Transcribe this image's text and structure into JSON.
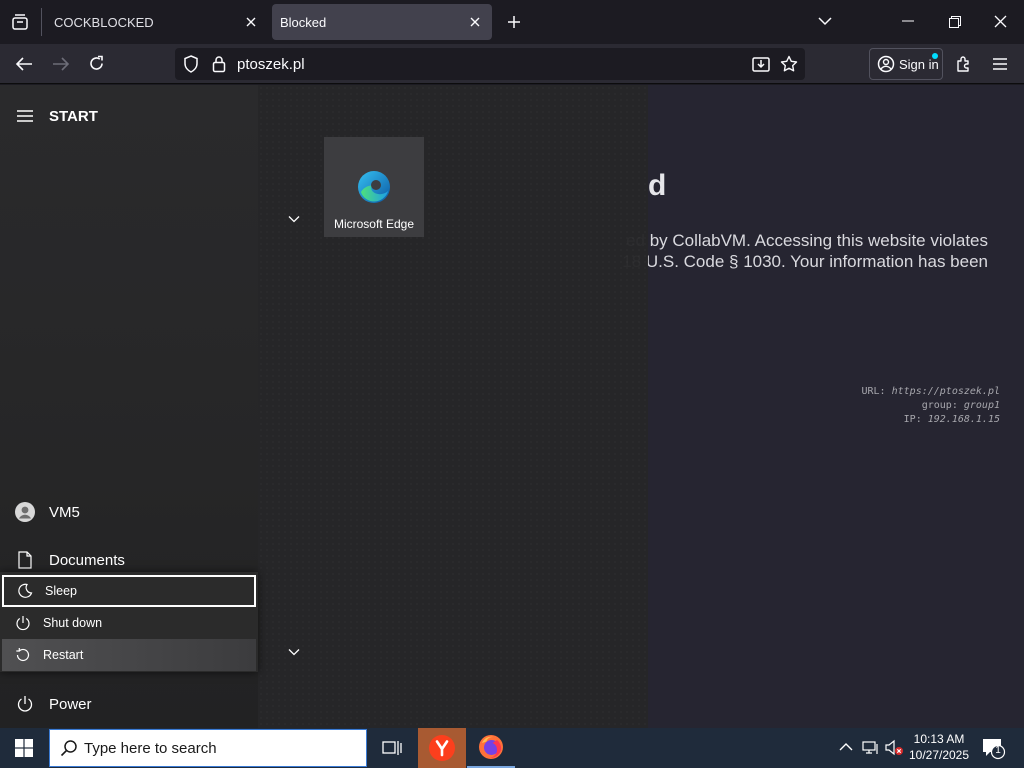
{
  "browser": {
    "tabs": [
      {
        "title": "COCKBLOCKED",
        "active": false
      },
      {
        "title": "Blocked",
        "active": true
      }
    ],
    "url": "ptoszek.pl",
    "sign_in_label": "Sign in"
  },
  "page": {
    "heading_visible_fragment": "d",
    "message_line1": "ed by CollabVM. Accessing this website violates",
    "message_line2": "18 U.S. Code § 1030. Your information has been",
    "meta": {
      "url_label": "URL:",
      "url_value": "https://ptoszek.pl",
      "group_label": "group:",
      "group_value": "group1",
      "ip_label": "IP:",
      "ip_value": "192.168.1.15"
    }
  },
  "start_menu": {
    "title": "START",
    "user": "VM5",
    "documents": "Documents",
    "power": "Power",
    "tile_edge": "Microsoft Edge",
    "power_options": [
      "Sleep",
      "Shut down",
      "Restart"
    ]
  },
  "taskbar": {
    "search_placeholder": "Type here to search",
    "time": "10:13 AM",
    "date": "10/27/2025",
    "notification_count": "1"
  },
  "colors": {
    "accent": "#3a7bd5",
    "yandex": "#fc3f1d",
    "taskbar": "#1f2b3b"
  }
}
